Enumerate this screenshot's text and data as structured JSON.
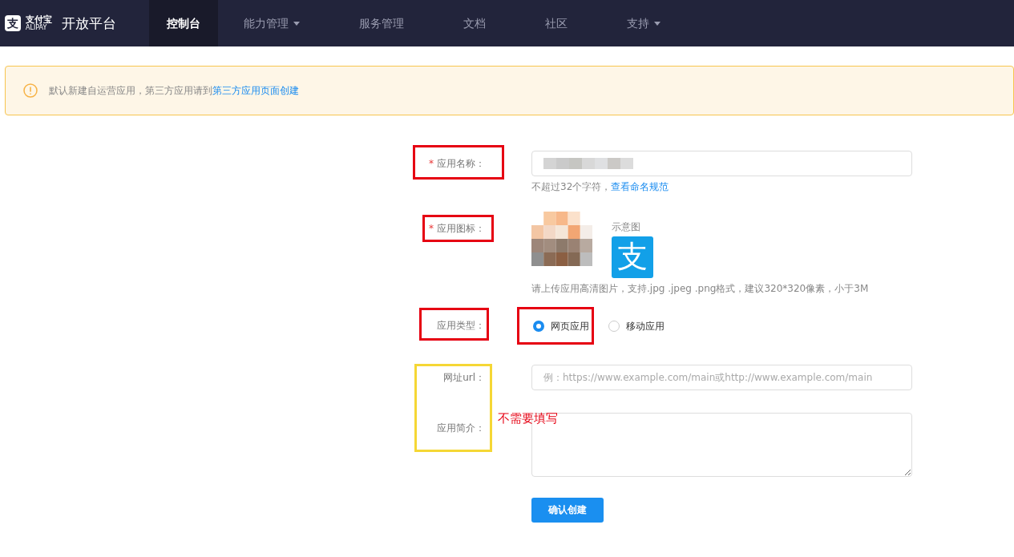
{
  "header": {
    "logo_mark": "支",
    "logo_name": "支付宝",
    "logo_sub": "ALIPAY",
    "platform": "开放平台",
    "nav": [
      {
        "label": "控制台",
        "selected": true,
        "dropdown": false
      },
      {
        "label": "能力管理",
        "selected": false,
        "dropdown": true
      },
      {
        "label": "服务管理",
        "selected": false,
        "dropdown": false
      },
      {
        "label": "文档",
        "selected": false,
        "dropdown": false
      },
      {
        "label": "社区",
        "selected": false,
        "dropdown": false
      },
      {
        "label": "支持",
        "selected": false,
        "dropdown": true
      }
    ]
  },
  "alert": {
    "text": "默认新建自运营应用，第三方应用请到",
    "link": "第三方应用页面创建"
  },
  "form": [
    {
      "kind": "input",
      "label": "应用名称：",
      "required": "*",
      "hint": "不超过32个字符，",
      "hint_link": "查看命名规范"
    },
    {
      "kind": "icon",
      "label": "应用图标：",
      "required": "*",
      "sample_label": "示意图",
      "sample_mark": "支",
      "hint": "请上传应用高清图片，支持.jpg .jpeg .png格式，建议320*320像素，小于3M"
    },
    {
      "kind": "radio",
      "label": "应用类型：",
      "options": [
        {
          "label": "网页应用",
          "selected": true
        },
        {
          "label": "移动应用",
          "selected": false
        }
      ]
    },
    {
      "kind": "input",
      "label": "网址url：",
      "placeholder": "例：https://www.example.com/main或http://www.example.com/main"
    },
    {
      "kind": "textarea",
      "label": "应用简介："
    }
  ],
  "submit": "确认创建",
  "annotations": [
    {
      "kind": "box",
      "color": "#e60012"
    },
    {
      "kind": "box",
      "color": "#e60012"
    },
    {
      "kind": "box",
      "color": "#e60012"
    },
    {
      "kind": "box",
      "color": "#e60012"
    },
    {
      "kind": "box",
      "color": "#f5d735"
    },
    {
      "kind": "note",
      "color": "#e60012",
      "text": "不需要填写"
    }
  ]
}
